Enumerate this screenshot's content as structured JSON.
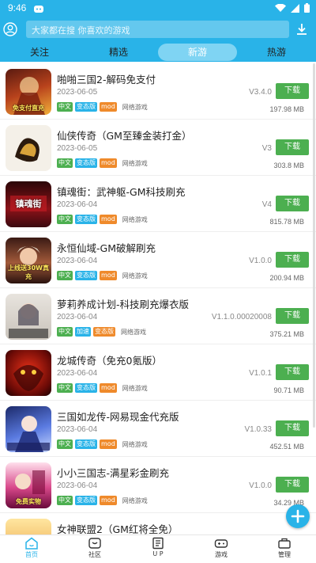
{
  "status_bar": {
    "time": "9:46"
  },
  "search": {
    "placeholder": "大家都在搜 你喜欢的游戏"
  },
  "tabs": [
    {
      "label": "关注"
    },
    {
      "label": "精选"
    },
    {
      "label": "新游"
    },
    {
      "label": "热游"
    }
  ],
  "active_tab": "新游",
  "games": [
    {
      "title": "啪啪三国2-解码免支付",
      "date": "2023-06-05",
      "version": "V3.4.0",
      "tags": [
        "中文",
        "变态版",
        "mod"
      ],
      "type": "网络游戏",
      "size": "197.98 MB",
      "button": "下载",
      "thumb_text": "免支付直充"
    },
    {
      "title": "仙侠传奇（GM至臻金装打金）",
      "date": "2023-06-05",
      "version": "V3",
      "tags": [
        "中文",
        "变态版",
        "mod"
      ],
      "type": "网络游戏",
      "size": "303.8 MB",
      "button": "下载",
      "thumb_text": ""
    },
    {
      "title": "镇魂街：武神躯-GM科技刷充",
      "date": "2023-06-04",
      "version": "V4",
      "tags": [
        "中文",
        "变态版",
        "mod"
      ],
      "type": "网络游戏",
      "size": "815.78 MB",
      "button": "下载",
      "thumb_text": "镇魂街"
    },
    {
      "title": "永恒仙域-GM破解刷充",
      "date": "2023-06-04",
      "version": "V1.0.0",
      "tags": [
        "中文",
        "变态版",
        "mod"
      ],
      "type": "网络游戏",
      "size": "200.94 MB",
      "button": "下载",
      "thumb_text": "上线送30W真充"
    },
    {
      "title": "萝莉养成计划-科技刷充爆衣版",
      "date": "2023-06-04",
      "version": "V1.1.0.00020008",
      "tags": [
        "中文",
        "加速",
        "变态版"
      ],
      "type": "网络游戏",
      "size": "375.21 MB",
      "button": "下载",
      "thumb_text": ""
    },
    {
      "title": "龙城传奇（免充0氪版）",
      "date": "2023-06-04",
      "version": "V1.0.1",
      "tags": [
        "中文",
        "变态版",
        "mod"
      ],
      "type": "网络游戏",
      "size": "90.71 MB",
      "button": "下载",
      "thumb_text": ""
    },
    {
      "title": "三国如龙传-网易现金代充版",
      "date": "2023-06-04",
      "version": "V1.0.33",
      "tags": [
        "中文",
        "变态版",
        "mod"
      ],
      "type": "网络游戏",
      "size": "452.51 MB",
      "button": "下载",
      "thumb_text": ""
    },
    {
      "title": "小小三国志-满星彩金刷充",
      "date": "2023-06-04",
      "version": "V1.0.0",
      "tags": [
        "中文",
        "变态版",
        "mod"
      ],
      "type": "网络游戏",
      "size": "34.29 MB",
      "button": "下载",
      "thumb_text": "免费实物"
    },
    {
      "title": "女神联盟2（GM红将全免）",
      "date": "",
      "version": "",
      "tags": [],
      "type": "",
      "size": "",
      "button": "",
      "thumb_text": ""
    }
  ],
  "bottom_nav": [
    {
      "label": "首页",
      "icon": "home-icon",
      "active": true
    },
    {
      "label": "社区",
      "icon": "community-icon",
      "active": false
    },
    {
      "label": "U P",
      "icon": "up-icon",
      "active": false
    },
    {
      "label": "游戏",
      "icon": "gamepad-icon",
      "active": false
    },
    {
      "label": "管理",
      "icon": "manage-icon",
      "active": false
    }
  ],
  "colors": {
    "brand": "#29b3e8",
    "download": "#4caf50",
    "mod_tag": "#ef8a2b",
    "tab_active": "#7fd4f3"
  }
}
